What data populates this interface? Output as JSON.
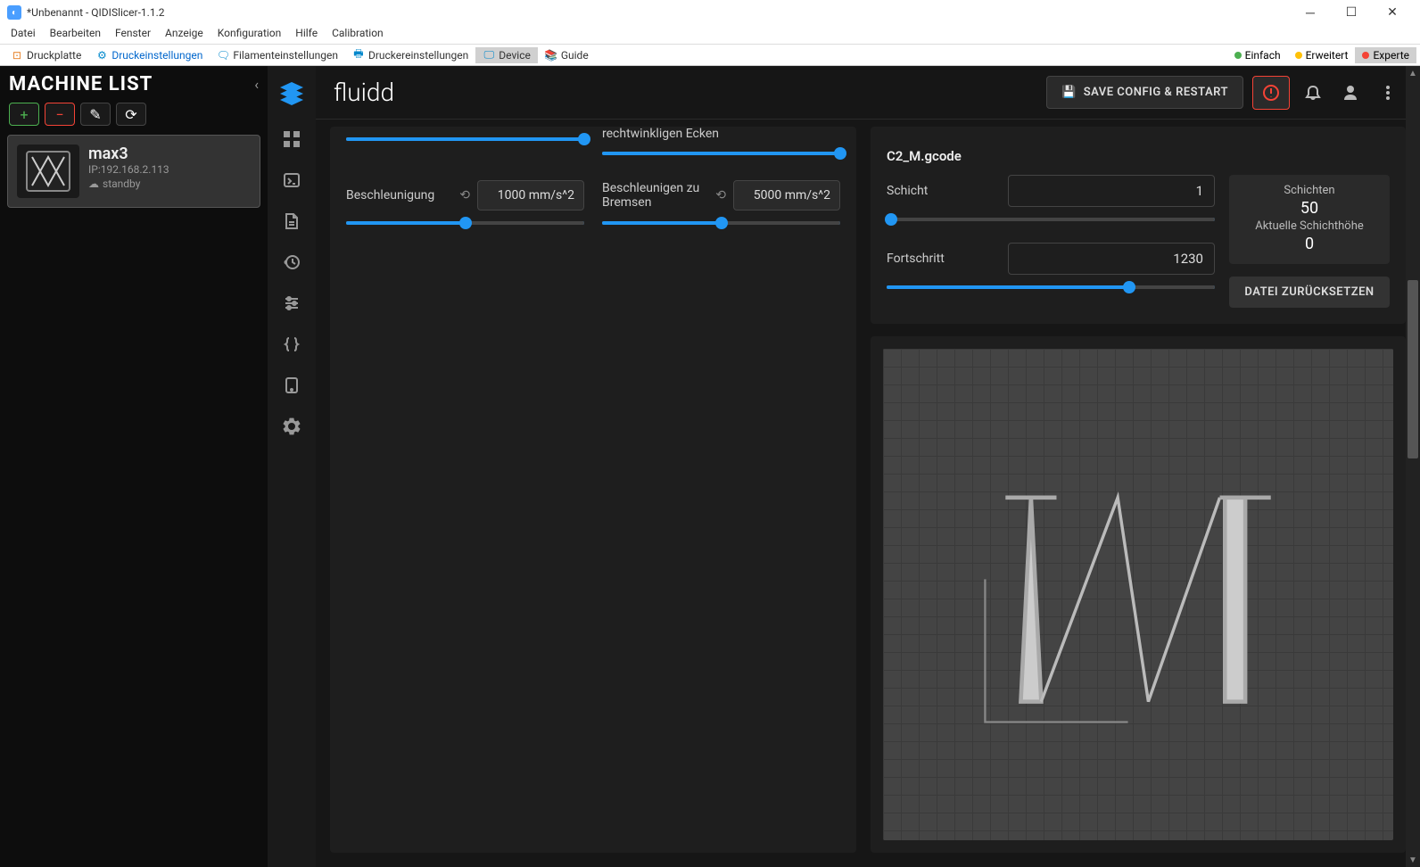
{
  "window": {
    "title": "*Unbenannt - QIDISlicer-1.1.2"
  },
  "menu": [
    "Datei",
    "Bearbeiten",
    "Fenster",
    "Anzeige",
    "Konfiguration",
    "Hilfe",
    "Calibration"
  ],
  "toolbar": {
    "items": [
      {
        "label": "Druckplatte"
      },
      {
        "label": "Druckeinstellungen"
      },
      {
        "label": "Filamenteinstellungen"
      },
      {
        "label": "Druckereinstellungen"
      },
      {
        "label": "Device"
      },
      {
        "label": "Guide"
      }
    ],
    "modes": [
      {
        "label": "Einfach"
      },
      {
        "label": "Erweitert"
      },
      {
        "label": "Experte"
      }
    ]
  },
  "machine_list": {
    "title": "MACHINE LIST",
    "items": [
      {
        "name": "max3",
        "ip": "IP:192.168.2.113",
        "status": "standby"
      }
    ]
  },
  "fluidd": {
    "title": "fluidd",
    "save_label": "SAVE CONFIG & RESTART",
    "controls": {
      "ecken_label": "rechtwinkligen Ecken",
      "ecken_slider_pct": 100,
      "top_slider_pct": 100,
      "accel_label": "Beschleunigung",
      "accel_value": "1000 mm/s^2",
      "accel_slider_pct": 50,
      "brake_label": "Beschleunigen zu Bremsen",
      "brake_value": "5000 mm/s^2",
      "brake_slider_pct": 50
    },
    "file": {
      "name": "C2_M.gcode",
      "schicht_label": "Schicht",
      "schicht_value": "1",
      "schicht_slider_pct": 0,
      "fortschritt_label": "Fortschritt",
      "fortschritt_value": "1230",
      "fortschritt_slider_pct": 74,
      "schichten_label": "Schichten",
      "schichten_value": "50",
      "aktuelle_label": "Aktuelle Schichthöhe",
      "aktuelle_value": "0",
      "reset_label": "DATEI ZURÜCKSETZEN"
    }
  }
}
